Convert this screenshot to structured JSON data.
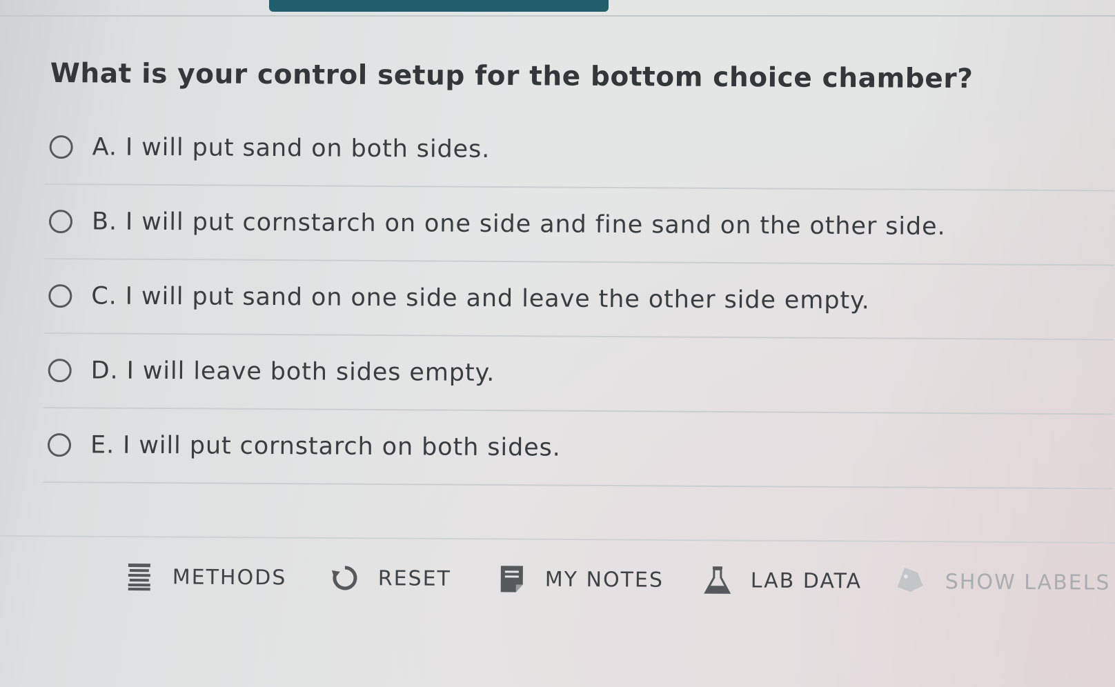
{
  "question": "What is your control setup for the bottom choice chamber?",
  "options": [
    {
      "label": "A. I will put sand on both sides."
    },
    {
      "label": "B. I will put cornstarch on one side and fine sand on the other side."
    },
    {
      "label": "C. I will put sand on one side and leave the other side empty."
    },
    {
      "label": "D. I will leave both sides empty."
    },
    {
      "label": "E. I will put cornstarch on both sides."
    }
  ],
  "toolbar": {
    "methods": {
      "label": "METHODS",
      "icon": "list-icon"
    },
    "reset": {
      "label": "RESET",
      "icon": "reset-icon"
    },
    "my_notes": {
      "label": "MY NOTES",
      "icon": "notes-icon"
    },
    "lab_data": {
      "label": "LAB DATA",
      "icon": "flask-icon"
    },
    "show_labels": {
      "label": "SHOW LABELS",
      "icon": "tag-icon"
    }
  },
  "colors": {
    "accent": "#1f5f6b",
    "text": "#3a3d40",
    "faded_text": "#a9adaf"
  }
}
